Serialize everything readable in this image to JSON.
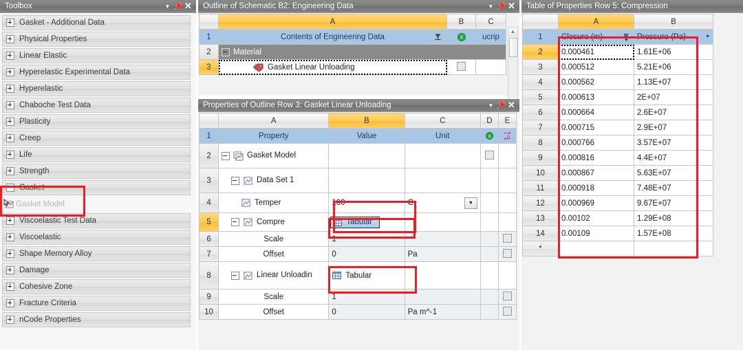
{
  "toolbox": {
    "title": "Toolbox",
    "window_buttons": [
      "menu-caret",
      "pin",
      "close"
    ],
    "groups": [
      {
        "label": "Gasket - Additional Data",
        "state": "collapsed"
      },
      {
        "label": "Physical Properties",
        "state": "collapsed"
      },
      {
        "label": "Linear Elastic",
        "state": "collapsed"
      },
      {
        "label": "Hyperelastic Experimental Data",
        "state": "collapsed"
      },
      {
        "label": "Hyperelastic",
        "state": "collapsed"
      },
      {
        "label": "Chaboche Test Data",
        "state": "collapsed"
      },
      {
        "label": "Plasticity",
        "state": "collapsed"
      },
      {
        "label": "Creep",
        "state": "collapsed"
      },
      {
        "label": "Life",
        "state": "collapsed"
      },
      {
        "label": "Strength",
        "state": "collapsed"
      },
      {
        "label": "Gasket",
        "state": "expanded"
      }
    ],
    "child_item": {
      "label": "Gasket Model"
    },
    "groups_after": [
      {
        "label": "Viscoelastic Test Data",
        "state": "collapsed"
      },
      {
        "label": "Viscoelastic",
        "state": "collapsed"
      },
      {
        "label": "Shape Memory Alloy",
        "state": "collapsed"
      },
      {
        "label": "Damage",
        "state": "collapsed"
      },
      {
        "label": "Cohesive Zone",
        "state": "collapsed"
      },
      {
        "label": "Fracture Criteria",
        "state": "collapsed"
      },
      {
        "label": "nCode Properties",
        "state": "collapsed"
      }
    ]
  },
  "outline": {
    "title": "Outline of Schematic B2: Engineering Data",
    "columns": [
      "A",
      "B",
      "C"
    ],
    "selected_column": "A",
    "header_row": {
      "num": "1",
      "a": "Contents of Engineering Data",
      "c": "ucrip"
    },
    "rows": [
      {
        "num": "2",
        "label": "Material",
        "type": "group"
      },
      {
        "num": "3",
        "label": "Gasket Linear Unloading",
        "type": "item"
      }
    ]
  },
  "properties": {
    "title": "Properties of Outline Row 3: Gasket Linear Unloading",
    "columns": [
      "A",
      "B",
      "C",
      "D",
      "E"
    ],
    "selected_column": "B",
    "header_row": {
      "num": "1",
      "a": "Property",
      "b": "Value",
      "c": "Unit"
    },
    "rows": [
      {
        "num": "2",
        "property": "Gasket Model",
        "value": "",
        "unit": "",
        "indent": 0,
        "expander": true,
        "icon": "gasket-model-icon",
        "checkbox": true
      },
      {
        "num": "3",
        "property": "Data Set 1",
        "value": "",
        "unit": "",
        "indent": 1,
        "expander": true,
        "icon": "chart-icon",
        "checkbox": false
      },
      {
        "num": "4",
        "property": "Temper",
        "value": "100",
        "unit": "C",
        "indent": 2,
        "expander": false,
        "icon": "chart-icon",
        "dropdown": true
      },
      {
        "num": "5",
        "property": "Compre",
        "value": "Tabular",
        "unit": "",
        "indent": 1,
        "expander": true,
        "icon": "chart-icon",
        "button": "active"
      },
      {
        "num": "6",
        "property": "Scale",
        "value": "1",
        "unit": "",
        "indent": 2,
        "expander": false,
        "checkbox": true
      },
      {
        "num": "7",
        "property": "Offset",
        "value": "0",
        "unit": "Pa",
        "indent": 2,
        "expander": false,
        "checkbox": true
      },
      {
        "num": "8",
        "property": "Linear Unloadin",
        "value": "Tabular",
        "unit": "",
        "indent": 1,
        "expander": true,
        "icon": "chart-icon",
        "button": "plain"
      },
      {
        "num": "9",
        "property": "Scale",
        "value": "1",
        "unit": "",
        "indent": 2,
        "expander": false,
        "checkbox": true
      },
      {
        "num": "10",
        "property": "Offset",
        "value": "0",
        "unit": "Pa m^-1",
        "indent": 2,
        "expander": false,
        "checkbox": true
      }
    ]
  },
  "table_of_properties": {
    "title": "Table of Properties Row 5: Compression",
    "columns": [
      "A",
      "B"
    ],
    "selected_column": "A",
    "headers": [
      "Closure (m)",
      "Pressure (Pa)"
    ],
    "selected_row": "2",
    "new_row_marker": "*",
    "rows": [
      {
        "num": "1",
        "closure": "Closure (m)",
        "pressure": "Pressure (Pa)"
      },
      {
        "num": "2",
        "closure": "0.000461",
        "pressure": "1.61E+06"
      },
      {
        "num": "3",
        "closure": "0.000512",
        "pressure": "5.21E+06"
      },
      {
        "num": "4",
        "closure": "0.000562",
        "pressure": "1.13E+07"
      },
      {
        "num": "5",
        "closure": "0.000613",
        "pressure": "2E+07"
      },
      {
        "num": "6",
        "closure": "0.000664",
        "pressure": "2.6E+07"
      },
      {
        "num": "7",
        "closure": "0.000715",
        "pressure": "2.9E+07"
      },
      {
        "num": "8",
        "closure": "0.000766",
        "pressure": "3.57E+07"
      },
      {
        "num": "9",
        "closure": "0.000816",
        "pressure": "4.4E+07"
      },
      {
        "num": "10",
        "closure": "0.000867",
        "pressure": "5.63E+07"
      },
      {
        "num": "11",
        "closure": "0.000918",
        "pressure": "7.48E+07"
      },
      {
        "num": "12",
        "closure": "0.000969",
        "pressure": "9.67E+07"
      },
      {
        "num": "13",
        "closure": "0.00102",
        "pressure": "1.29E+08"
      },
      {
        "num": "14",
        "closure": "0.00109",
        "pressure": "1.57E+08"
      }
    ]
  },
  "annotation": {
    "color": "#ee1c25",
    "count": 5
  }
}
